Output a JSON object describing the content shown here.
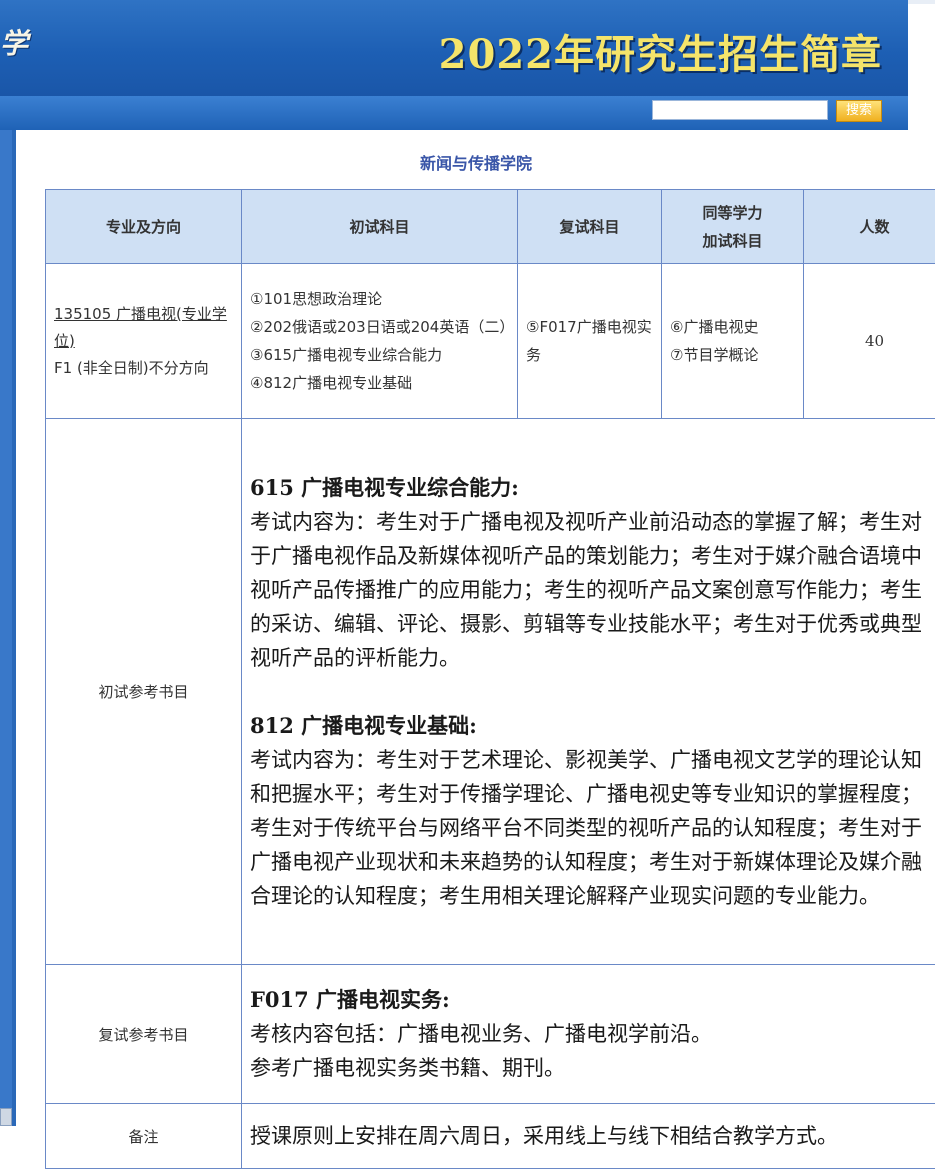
{
  "header": {
    "logo_text": "学",
    "title": "2022年研究生招生简章",
    "search_placeholder": "",
    "search_button": "搜索"
  },
  "college": "新闻与传播学院",
  "table": {
    "headers": {
      "major": "专业及方向",
      "initial": "初试科目",
      "retest": "复试科目",
      "extra_line1": "同等学力",
      "extra_line2": "加试科目",
      "count": "人数"
    },
    "row": {
      "major_link": "135105 广播电视(专业学位)",
      "major_mode": "F1 (非全日制)不分方向",
      "initial_subjects": [
        "①101思想政治理论",
        "②202俄语或203日语或204英语（二）",
        "③615广播电视专业综合能力",
        "④812广播电视专业基础"
      ],
      "retest_subject": "⑤F017广播电视实务",
      "extra_subjects": [
        "⑥广播电视史",
        "⑦节目学概论"
      ],
      "count": "40"
    },
    "initial_refs": {
      "label": "初试参考书目",
      "s1_head": "615 广播电视专业综合能力:",
      "s1_body": "考试内容为：考生对于广播电视及视听产业前沿动态的掌握了解；考生对于广播电视作品及新媒体视听产品的策划能力；考生对于媒介融合语境中视听产品传播推广的应用能力；考生的视听产品文案创意写作能力；考生的采访、编辑、评论、摄影、剪辑等专业技能水平；考生对于优秀或典型视听产品的评析能力。",
      "s2_head": "812 广播电视专业基础:",
      "s2_body": "考试内容为：考生对于艺术理论、影视美学、广播电视文艺学的理论认知和把握水平；考生对于传播学理论、广播电视史等专业知识的掌握程度；考生对于传统平台与网络平台不同类型的视听产品的认知程度；考生对于广播电视产业现状和未来趋势的认知程度；考生对于新媒体理论及媒介融合理论的认知程度；考生用相关理论解释产业现实问题的专业能力。"
    },
    "retest_refs": {
      "label": "复试参考书目",
      "head": "F017 广播电视实务:",
      "line1": "考核内容包括：广播电视业务、广播电视学前沿。",
      "line2": "参考广播电视实务类书籍、期刊。"
    },
    "notes": {
      "label": "备注",
      "text": "授课原则上安排在周六周日，采用线上与线下相结合教学方式。"
    }
  }
}
